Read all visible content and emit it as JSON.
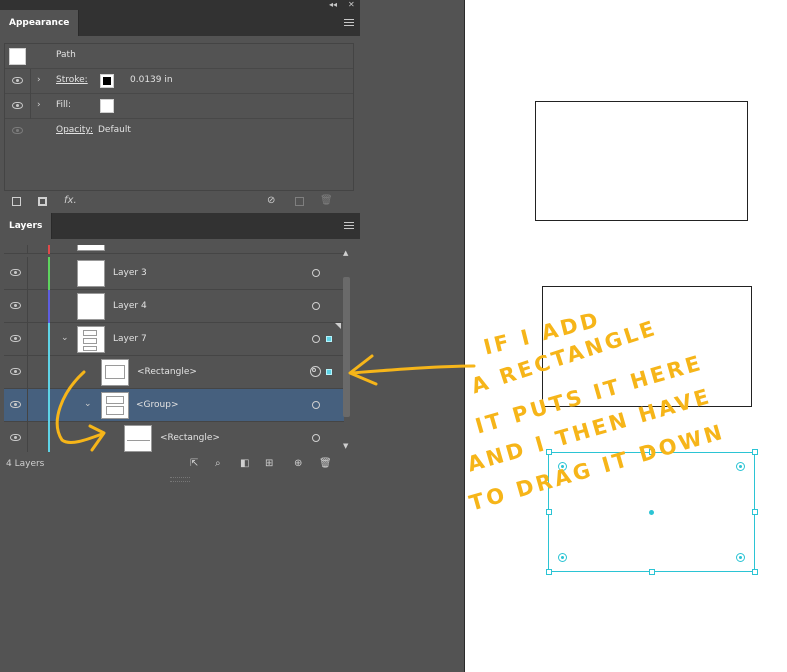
{
  "dock": {
    "collapse_label": "◂◂",
    "close_label": "✕"
  },
  "appearance": {
    "tab_label": "Appearance",
    "object_type": "Path",
    "rows": [
      {
        "label": "Stroke:",
        "value": "0.0139 in",
        "swatch_color": "#000000"
      },
      {
        "label": "Fill:",
        "value": "",
        "swatch_color": "#ffffff"
      },
      {
        "label": "Opacity:",
        "value": "Default"
      }
    ],
    "fx_label": "fx.",
    "icons": [
      "new-art-stroke-icon",
      "new-art-fill-icon",
      "fx-icon",
      "clear-appearance-icon",
      "duplicate-item-icon",
      "delete-item-icon"
    ]
  },
  "layers": {
    "tab_label": "Layers",
    "rows": [
      {
        "name": "Layer 3",
        "color": "#5ed35e",
        "level": 0
      },
      {
        "name": "Layer 4",
        "color": "#5e5ee0",
        "level": 0
      },
      {
        "name": "Layer 7",
        "color": "#5ed3e6",
        "level": 0,
        "expanded": true
      },
      {
        "name": "<Rectangle>",
        "color": "#5ed3e6",
        "level": 1
      },
      {
        "name": "<Group>",
        "color": "#5ed3e6",
        "level": 1,
        "expanded": true,
        "selected": true
      },
      {
        "name": "<Rectangle>",
        "color": "#5ed3e6",
        "level": 2
      }
    ],
    "count_label": "4 Layers",
    "footer_icons": [
      "collect-for-export-icon",
      "locate-object-icon",
      "make-clipping-mask-icon",
      "create-sublayer-icon",
      "create-layer-icon",
      "delete-layer-icon"
    ]
  },
  "annotation": {
    "lines": [
      "IF I ADD",
      "A RECTANGLE",
      "IT PUTS IT HERE",
      "AND I THEN HAVE",
      "TO DRAG IT DOWN"
    ],
    "color": "#f6b519"
  },
  "canvas": {
    "background": "#ffffff",
    "selection_color": "#2bc4d4"
  }
}
